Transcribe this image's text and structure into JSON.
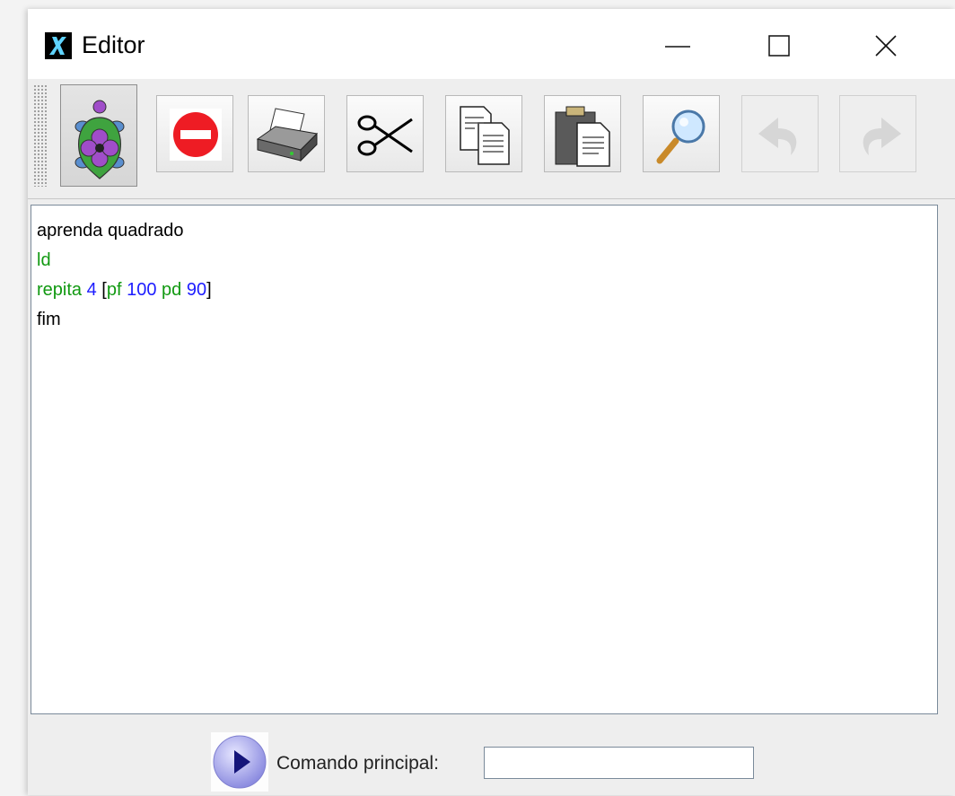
{
  "window": {
    "title": "Editor",
    "controls": [
      "minimize",
      "maximize",
      "close"
    ]
  },
  "toolbar": {
    "buttons": [
      {
        "icon": "turtle-icon",
        "state": "pressed"
      },
      {
        "icon": "stop-icon",
        "state": "enabled"
      },
      {
        "icon": "printer-icon",
        "state": "enabled"
      },
      {
        "icon": "scissors-icon",
        "state": "enabled"
      },
      {
        "icon": "copy-icon",
        "state": "enabled"
      },
      {
        "icon": "paste-icon",
        "state": "enabled"
      },
      {
        "icon": "magnifier-icon",
        "state": "enabled"
      },
      {
        "icon": "undo-icon",
        "state": "disabled"
      },
      {
        "icon": "redo-icon",
        "state": "disabled"
      }
    ]
  },
  "editor": {
    "lines": [
      [
        {
          "text": "aprenda quadrado",
          "color": "black"
        }
      ],
      [
        {
          "text": "ld",
          "color": "green"
        }
      ],
      [
        {
          "text": "repita ",
          "color": "green"
        },
        {
          "text": "4",
          "color": "blue"
        },
        {
          "text": " [",
          "color": "black"
        },
        {
          "text": "pf ",
          "color": "green"
        },
        {
          "text": "100",
          "color": "blue"
        },
        {
          "text": " pd ",
          "color": "green"
        },
        {
          "text": "90",
          "color": "blue"
        },
        {
          "text": "]",
          "color": "black"
        }
      ],
      [
        {
          "text": "fim",
          "color": "black"
        }
      ]
    ]
  },
  "footer": {
    "command_label": "Comando principal:",
    "command_value": ""
  },
  "colors": {
    "keyword": "#119911",
    "number": "#1c1cff",
    "text": "#000000"
  }
}
